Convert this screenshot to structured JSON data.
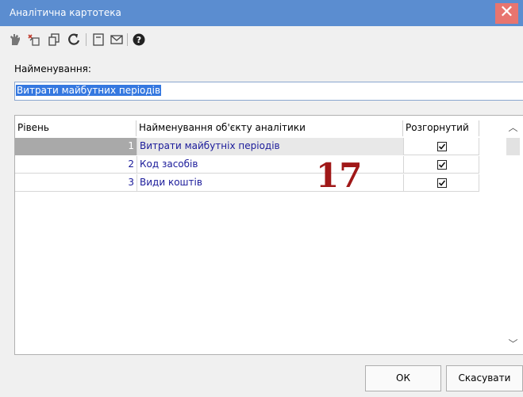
{
  "window": {
    "title": "Аналітична картотека",
    "close_label": "✕"
  },
  "toolbar": {
    "icons": [
      "hand-icon",
      "add-icon",
      "copy-icon",
      "refresh-icon",
      "form-icon",
      "mail-icon",
      "help-icon"
    ]
  },
  "form": {
    "name_label": "Найменування:",
    "name_value": "Витрати майбутних періодів"
  },
  "grid": {
    "columns": [
      "Рівень",
      "Найменування об'єкту аналітики",
      "Розгорнутий"
    ],
    "rows": [
      {
        "level": "1",
        "name": "Витрати майбутніх періодів",
        "expanded": true
      },
      {
        "level": "2",
        "name": "Код засобів",
        "expanded": true
      },
      {
        "level": "3",
        "name": "Види коштів",
        "expanded": true
      }
    ],
    "selected_row": 0
  },
  "annotation": "17",
  "buttons": {
    "ok": "ОК",
    "cancel": "Скасувати"
  },
  "colors": {
    "titlebar": "#5b8dd0",
    "close": "#e8756f",
    "selection": "#3578e0",
    "link_text": "#1a1a9a",
    "annotation": "#a01818"
  }
}
